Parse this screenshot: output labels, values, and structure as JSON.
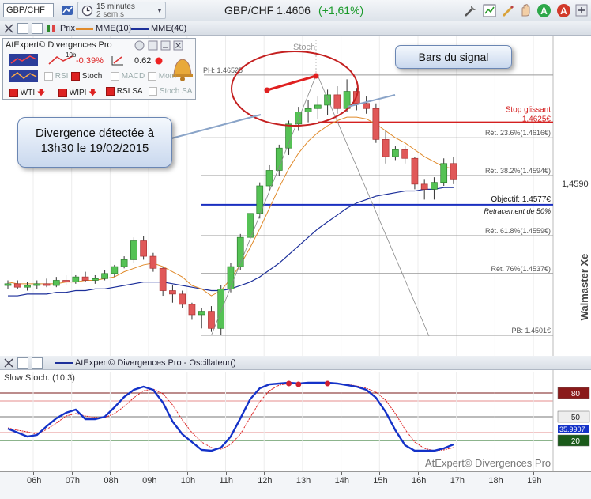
{
  "toolbar": {
    "symbol": "GBP/CHF",
    "timeframe": "15 minutes",
    "period": "2 sem.s",
    "title": "GBP/CHF  1.4606",
    "change": "(+1,61%)"
  },
  "chart_bar": {
    "legend": [
      {
        "label": "Prix",
        "color": "#2e8b2e"
      },
      {
        "label": "MME(10)",
        "color": "#e08a2a"
      },
      {
        "label": "MME(40)",
        "color": "#1c2f9a"
      }
    ]
  },
  "panel": {
    "title": "AtExpert© Divergences Pro",
    "pct": "-0.39%",
    "value": "0.62",
    "row2": [
      "RSI",
      "Stoch",
      "MACD",
      "Mom"
    ],
    "row3": [
      "WTI",
      "WIPI",
      "RSI SA",
      "Stoch SA"
    ]
  },
  "annotations": {
    "divergence": "Divergence détectée à 13h30 le 19/02/2015",
    "signal_bars": "Bars du signal",
    "stoch_label": "Stoch",
    "watermark": "Walmaster Xe"
  },
  "levels": {
    "ph": "PH: 1.46525",
    "stop": "Stop glissant",
    "stop_val": "1.4625€",
    "ret236": "Rét. 23.6%(1.4616€)",
    "ret382": "Rét. 38.2%(1.4594€)",
    "objectif": "Objectif: 1.4577€",
    "retrace": "Retracement de 50%",
    "ret618": "Rét. 61.8%(1.4559€)",
    "ret76": "Rét. 76%(1.4537€)",
    "pb": "PB: 1.4501€",
    "yaxis": "1,4590"
  },
  "stoch": {
    "header": "AtExpert© Divergences Pro - Oscillateur()",
    "label": "Slow Stoch. (10,3)",
    "watermark": "AtExpert© Divergences Pro",
    "levels": [
      "80",
      "50",
      "20"
    ],
    "current": "35.9907"
  },
  "xaxis": [
    "06h",
    "07h",
    "08h",
    "09h",
    "10h",
    "11h",
    "12h",
    "13h",
    "14h",
    "15h",
    "16h",
    "17h",
    "18h",
    "19h"
  ],
  "chart_data": {
    "type": "candlestick",
    "x_start": "05:45",
    "interval_minutes": 15,
    "candles": [
      [
        1.453,
        1.4533,
        1.4528,
        1.4531
      ],
      [
        1.4531,
        1.4533,
        1.4528,
        1.4529
      ],
      [
        1.4529,
        1.4532,
        1.4527,
        1.453
      ],
      [
        1.453,
        1.4533,
        1.4528,
        1.4531
      ],
      [
        1.4531,
        1.4534,
        1.4529,
        1.453
      ],
      [
        1.453,
        1.4535,
        1.4529,
        1.4533
      ],
      [
        1.4533,
        1.4536,
        1.453,
        1.4532
      ],
      [
        1.4532,
        1.4536,
        1.4531,
        1.4535
      ],
      [
        1.4535,
        1.4538,
        1.4532,
        1.4533
      ],
      [
        1.4533,
        1.4536,
        1.4531,
        1.4534
      ],
      [
        1.4534,
        1.4539,
        1.4533,
        1.4537
      ],
      [
        1.4537,
        1.4542,
        1.4535,
        1.4541
      ],
      [
        1.4541,
        1.4547,
        1.454,
        1.4545
      ],
      [
        1.4545,
        1.4558,
        1.4543,
        1.4556
      ],
      [
        1.4556,
        1.4559,
        1.4545,
        1.4547
      ],
      [
        1.4547,
        1.4549,
        1.4538,
        1.454
      ],
      [
        1.454,
        1.4541,
        1.4524,
        1.4527
      ],
      [
        1.4527,
        1.453,
        1.452,
        1.4525
      ],
      [
        1.4525,
        1.4527,
        1.4517,
        1.4519
      ],
      [
        1.4519,
        1.452,
        1.451,
        1.4513
      ],
      [
        1.4513,
        1.4517,
        1.4505,
        1.4515
      ],
      [
        1.4515,
        1.4518,
        1.4503,
        1.4505
      ],
      [
        1.4505,
        1.453,
        1.4501,
        1.4528
      ],
      [
        1.4528,
        1.4543,
        1.4526,
        1.4541
      ],
      [
        1.4541,
        1.456,
        1.4539,
        1.4558
      ],
      [
        1.4558,
        1.4575,
        1.4556,
        1.4572
      ],
      [
        1.4572,
        1.459,
        1.4569,
        1.4588
      ],
      [
        1.4588,
        1.46,
        1.4585,
        1.4597
      ],
      [
        1.4597,
        1.4612,
        1.4594,
        1.461
      ],
      [
        1.461,
        1.4626,
        1.4606,
        1.4624
      ],
      [
        1.4624,
        1.4634,
        1.462,
        1.4631
      ],
      [
        1.4631,
        1.4638,
        1.4625,
        1.4633
      ],
      [
        1.4633,
        1.464,
        1.4627,
        1.4635
      ],
      [
        1.4635,
        1.4644,
        1.4629,
        1.4641
      ],
      [
        1.4641,
        1.4646,
        1.463,
        1.4633
      ],
      [
        1.4633,
        1.465,
        1.4631,
        1.4643
      ],
      [
        1.4643,
        1.4645,
        1.4632,
        1.4636
      ],
      [
        1.4636,
        1.464,
        1.463,
        1.4633
      ],
      [
        1.4633,
        1.4636,
        1.4613,
        1.4615
      ],
      [
        1.4615,
        1.462,
        1.4601,
        1.4605
      ],
      [
        1.4605,
        1.4611,
        1.4603,
        1.4609
      ],
      [
        1.4609,
        1.4611,
        1.4601,
        1.4604
      ],
      [
        1.4604,
        1.4605,
        1.4586,
        1.4589
      ],
      [
        1.4589,
        1.4592,
        1.458,
        1.4586
      ],
      [
        1.4586,
        1.4593,
        1.458,
        1.459
      ],
      [
        1.459,
        1.4604,
        1.4588,
        1.4601
      ],
      [
        1.4601,
        1.4605,
        1.4589,
        1.4592
      ]
    ],
    "mme10": [
      1.4532,
      1.4531,
      1.4531,
      1.4531,
      1.4531,
      1.4531,
      1.4532,
      1.4532,
      1.4533,
      1.4533,
      1.4534,
      1.4535,
      1.4538,
      1.454,
      1.4542,
      1.4543,
      1.4541,
      1.4538,
      1.4535,
      1.453,
      1.4528,
      1.4524,
      1.4527,
      1.4534,
      1.4542,
      1.4552,
      1.4563,
      1.4575,
      1.4587,
      1.4598,
      1.4607,
      1.4614,
      1.4619,
      1.4623,
      1.4626,
      1.4628,
      1.4628,
      1.4627,
      1.4624,
      1.462,
      1.4616,
      1.4613,
      1.4609,
      1.4605,
      1.4602,
      1.4599,
      1.4598
    ],
    "mme40": [
      1.4524,
      1.4524,
      1.4525,
      1.4525,
      1.4525,
      1.4526,
      1.4526,
      1.4527,
      1.4527,
      1.4528,
      1.4528,
      1.4529,
      1.453,
      1.4531,
      1.4532,
      1.4532,
      1.4532,
      1.4531,
      1.453,
      1.4529,
      1.4528,
      1.4527,
      1.4527,
      1.4528,
      1.453,
      1.4532,
      1.4535,
      1.4539,
      1.4543,
      1.4548,
      1.4553,
      1.4558,
      1.4563,
      1.4567,
      1.4571,
      1.4575,
      1.4578,
      1.458,
      1.4582,
      1.4583,
      1.4584,
      1.4585,
      1.4585,
      1.4586,
      1.4586,
      1.4587,
      1.4587
    ],
    "stoch_k": [
      35,
      30,
      25,
      27,
      38,
      48,
      55,
      59,
      47,
      47,
      50,
      62,
      75,
      84,
      88,
      84,
      68,
      44,
      28,
      18,
      8,
      7,
      11,
      25,
      48,
      72,
      86,
      91,
      92,
      93,
      92,
      93,
      93,
      93,
      92,
      90,
      88,
      84,
      74,
      56,
      33,
      14,
      7,
      7,
      7,
      10,
      15
    ],
    "stoch_d": [
      36,
      33,
      31,
      28,
      34,
      42,
      51,
      54,
      51,
      49,
      49,
      54,
      63,
      74,
      83,
      85,
      79,
      65,
      46,
      30,
      18,
      11,
      9,
      15,
      28,
      49,
      69,
      83,
      90,
      92,
      92,
      92,
      92,
      93,
      92,
      91,
      89,
      86,
      81,
      71,
      54,
      34,
      18,
      10,
      7,
      8,
      11
    ]
  }
}
